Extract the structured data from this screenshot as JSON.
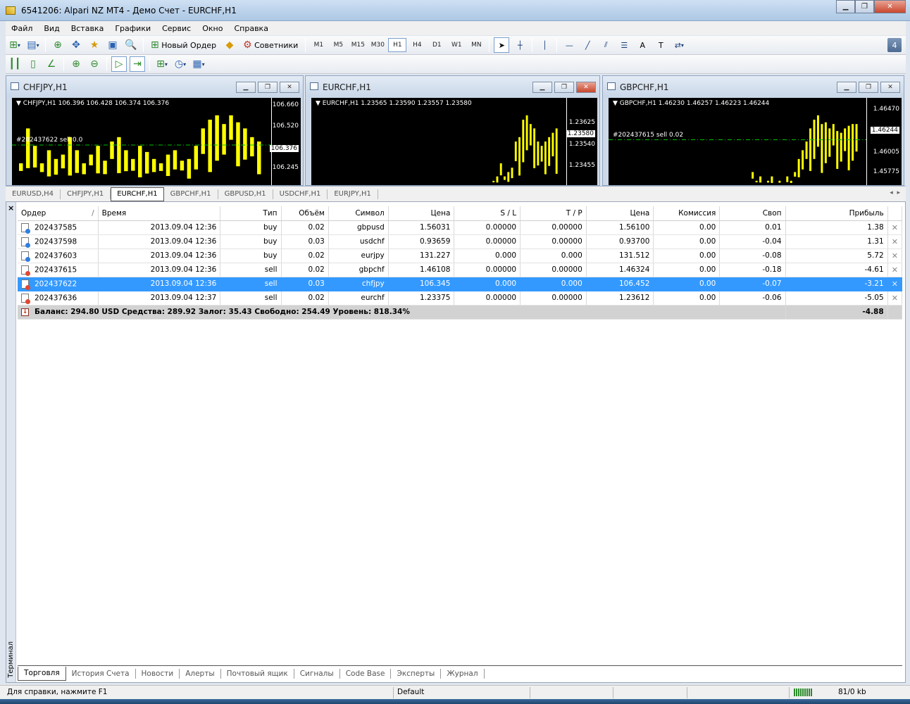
{
  "window": {
    "title": "6541206: Alpari NZ MT4 - Демо Счет - EURCHF,H1"
  },
  "menu": [
    "Файл",
    "Вид",
    "Вставка",
    "Графики",
    "Сервис",
    "Окно",
    "Справка"
  ],
  "toolbar": {
    "new_order": "Новый Ордер",
    "advisors": "Советники",
    "timeframes": [
      "M1",
      "M5",
      "M15",
      "M30",
      "H1",
      "H4",
      "D1",
      "W1",
      "MN"
    ],
    "active_timeframe": "H1",
    "notifications": "4"
  },
  "charts": [
    {
      "title": "CHFJPY,H1",
      "header": "CHFJPY,H1  106.396 106.428 106.374 106.376",
      "prices": [
        "106.660",
        "106.520",
        "106.376",
        "106.245"
      ],
      "current": "106.376",
      "order_label": "#202437622 sell 0.0"
    },
    {
      "title": "EURCHF,H1",
      "header": "EURCHF,H1  1.23565 1.23590 1.23557 1.23580",
      "prices": [
        "1.23625",
        "1.23580",
        "1.23540",
        "1.23455"
      ],
      "current": "1.23580",
      "order_label": ""
    },
    {
      "title": "GBPCHF,H1",
      "header": "GBPCHF,H1  1.46230 1.46257 1.46223 1.46244",
      "prices": [
        "1.46470",
        "1.46244",
        "1.46005",
        "1.45775"
      ],
      "current": "1.46244",
      "order_label": "#202437615 sell 0.02"
    }
  ],
  "chart_tabs": [
    "EURUSD,H4",
    "CHFJPY,H1",
    "EURCHF,H1",
    "GBPCHF,H1",
    "GBPUSD,H1",
    "USDCHF,H1",
    "EURJPY,H1"
  ],
  "active_chart_tab": "EURCHF,H1",
  "terminal": {
    "side_label": "Терминал",
    "columns": [
      "Ордер",
      "/",
      "Время",
      "Тип",
      "Объём",
      "Символ",
      "Цена",
      "S / L",
      "T / P",
      "Цена",
      "Комиссия",
      "Своп",
      "Прибыль"
    ],
    "orders": [
      {
        "id": "202437585",
        "time": "2013.09.04 12:36",
        "type": "buy",
        "volume": "0.02",
        "symbol": "gbpusd",
        "price": "1.56031",
        "sl": "0.00000",
        "tp": "0.00000",
        "cur": "1.56100",
        "commission": "0.00",
        "swap": "0.01",
        "profit": "1.38"
      },
      {
        "id": "202437598",
        "time": "2013.09.04 12:36",
        "type": "buy",
        "volume": "0.03",
        "symbol": "usdchf",
        "price": "0.93659",
        "sl": "0.00000",
        "tp": "0.00000",
        "cur": "0.93700",
        "commission": "0.00",
        "swap": "-0.04",
        "profit": "1.31"
      },
      {
        "id": "202437603",
        "time": "2013.09.04 12:36",
        "type": "buy",
        "volume": "0.02",
        "symbol": "eurjpy",
        "price": "131.227",
        "sl": "0.000",
        "tp": "0.000",
        "cur": "131.512",
        "commission": "0.00",
        "swap": "-0.08",
        "profit": "5.72"
      },
      {
        "id": "202437615",
        "time": "2013.09.04 12:36",
        "type": "sell",
        "volume": "0.02",
        "symbol": "gbpchf",
        "price": "1.46108",
        "sl": "0.00000",
        "tp": "0.00000",
        "cur": "1.46324",
        "commission": "0.00",
        "swap": "-0.18",
        "profit": "-4.61"
      },
      {
        "id": "202437622",
        "time": "2013.09.04 12:36",
        "type": "sell",
        "volume": "0.03",
        "symbol": "chfjpy",
        "price": "106.345",
        "sl": "0.000",
        "tp": "0.000",
        "cur": "106.452",
        "commission": "0.00",
        "swap": "-0.07",
        "profit": "-3.21"
      },
      {
        "id": "202437636",
        "time": "2013.09.04 12:37",
        "type": "sell",
        "volume": "0.02",
        "symbol": "eurchf",
        "price": "1.23375",
        "sl": "0.00000",
        "tp": "0.00000",
        "cur": "1.23612",
        "commission": "0.00",
        "swap": "-0.06",
        "profit": "-5.05"
      }
    ],
    "selected_order": "202437622",
    "summary": "Баланс: 294.80 USD  Средства: 289.92  Залог: 35.43  Свободно: 254.49  Уровень: 818.34%",
    "summary_profit": "-4.88",
    "tabs": [
      "Торговля",
      "История Счета",
      "Новости",
      "Алерты",
      "Почтовый ящик",
      "Сигналы",
      "Code Base",
      "Эксперты",
      "Журнал"
    ],
    "active_tab": "Торговля"
  },
  "statusbar": {
    "help": "Для справки, нажмите F1",
    "profile": "Default",
    "traffic": "81/0 kb"
  }
}
